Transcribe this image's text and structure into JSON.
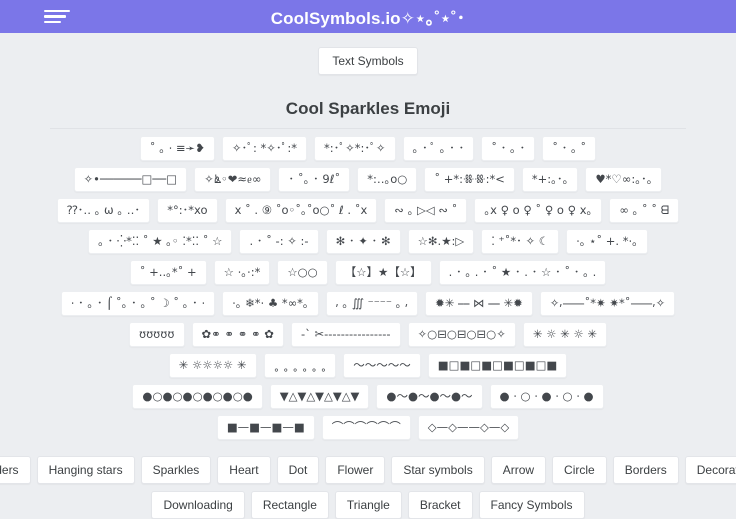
{
  "header": {
    "brand": "CoolSymbols.io✧⋆｡˚⋆˚･",
    "menu_label": "menu"
  },
  "tabs": {
    "text_symbols": "Text Symbols"
  },
  "section": {
    "title": "Cool Sparkles Emoji"
  },
  "symbol_rows": [
    [
      "˚ ｡ ⋅ ≡➛❥",
      "✧･ﾟ: *✧･ﾟ:*",
      "*:･ﾟ✧*:･ﾟ✧",
      "｡ ･ ﾟ ｡ ･ ･",
      "˚ ･ ｡ ･",
      "˚ ･ ｡ ˚"
    ],
    [
      "✧•──────□──□",
      "✧ൔ◦❤≈ᧉ∞",
      "･ ˚｡ ･ 9ℓ˚",
      "*:‥｡o○",
      "˚ +*:ꗥꗥ:*<",
      "*+:｡･｡",
      "♥*♡∞:｡･｡"
    ],
    [
      "⁇･‥ ｡ ω ｡ ‥･",
      "*°:･*xo",
      "x ˚ . ⑨ ˚o◦˚｡˚o○˚ ℓ . ˚x",
      "∾ ｡ ▷◁ ∾ ˚",
      "｡x ♀ o ♀ ˚ ♀ o ♀ x｡",
      "∞ ｡ ˚ ˚ ᗺ"
    ],
    [
      "｡ ･ ⁛*⁚⁚ ˚ ★ ｡◦ ⁚*⁚⁚ ˚ ☆",
      ". ･ ˚ -: ✧ :-",
      "✻ ･ ✦ ･ ✻",
      "☆✻.★:▷",
      "⁚ ⁺˚*･ ✧ ☾",
      "⋅｡ ⋆˚ +. *⋅｡"
    ],
    [
      "˚ +..｡*˚ +",
      "☆ ⋅｡⋅:*",
      "☆○○",
      "【☆】★【☆】",
      ". ･ ｡ . ･ ˚ ★ ･ . ･ ☆ ･ ˚ ･ ｡ ."
    ],
    [
      "⋅ ･ ｡ ･ ⌠ ˚｡ ･ ｡ ˚ ☽ ˚ ｡ ･ ⋅",
      "⋅｡ ❄*⋅ ♣ *∞*｡",
      "⸴ ｡ ∭ ⁻⁻⁻⁻ ｡ ⸴",
      "✹✳ ⎯⎯ ⋈ ⎯⎯ ✳✹",
      "✧⸴⸺˚*✷ ✷*˚⸺⸴✧"
    ],
    [
      "ʊʊʊʊʊ",
      "✿⚭ ⚭ ⚭ ⚭ ✿",
      "-` ✂︎----------------",
      "✧○⊟○⊟○⊟○✧",
      "✳ ☼ ✳ ☼ ✳"
    ],
    [
      "✳ ☼☼☼☼ ✳",
      "˳ ˳ ˳ ˳ ˳ ˳",
      "〜〜〜〜〜",
      "■□■□■□■□■□■"
    ],
    [
      "●○●○●○●○●○●",
      "▼△▼△▼△▼△▼",
      "●〜●〜●〜●〜",
      "● ⋅ ○ ⋅ ● ⋅ ○ ⋅ ●"
    ],
    [
      "■—■—■—■",
      "⌒⌒⌒⌒⌒⌒",
      "◇—◇——◇—◇"
    ]
  ],
  "tag_rows": [
    [
      "Dividers",
      "Hanging stars",
      "Sparkles",
      "Heart",
      "Dot",
      "Flower",
      "Star symbols",
      "Arrow",
      "Circle",
      "Borders",
      "Decorations"
    ],
    [
      "Downloading",
      "Rectangle",
      "Triangle",
      "Bracket",
      "Fancy Symbols"
    ]
  ],
  "colors": {
    "header_purple": "#7b76e8",
    "page_bg": "#eceef1",
    "card_bg": "#ffffff",
    "text": "#3c4043"
  }
}
